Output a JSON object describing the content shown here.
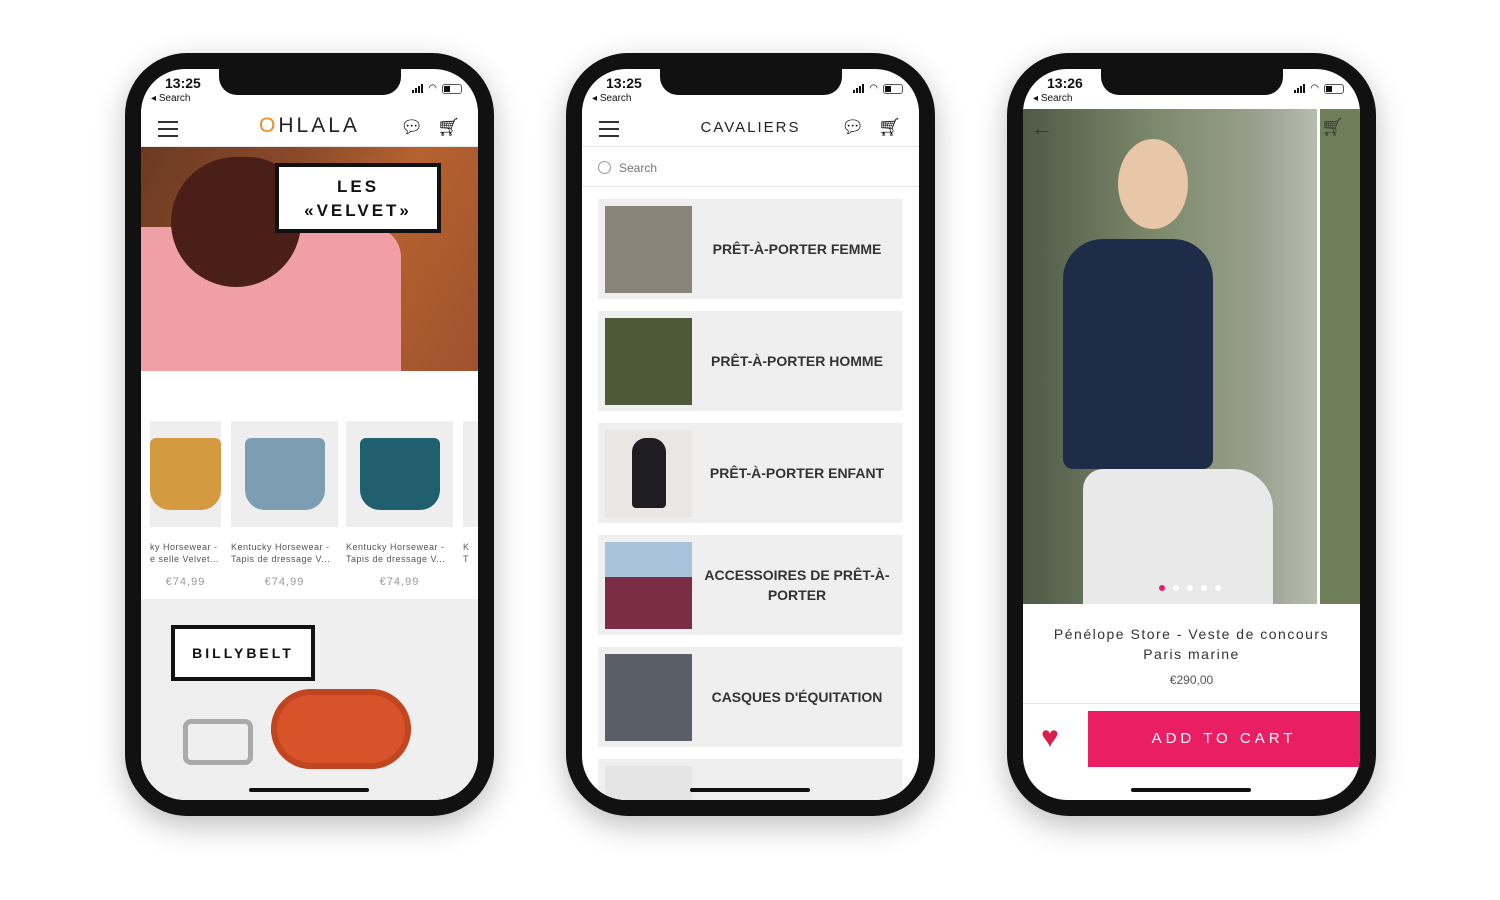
{
  "phones": [
    {
      "time": "13:25",
      "back": "Search",
      "logo_o": "O",
      "logo_rest": "HLALA",
      "hero": {
        "bubble": "LES «VELVET»"
      },
      "products": [
        {
          "title1": "ky Horsewear -",
          "title2": "e selle Velvet...",
          "price": "€74,99",
          "color": "#d39a3f"
        },
        {
          "title1": "Kentucky Horsewear -",
          "title2": "Tapis de dressage V...",
          "price": "€74,99",
          "color": "#7d9db2"
        },
        {
          "title1": "Kentucky Horsewear -",
          "title2": "Tapis de dressage V...",
          "price": "€74,99",
          "color": "#1f5f6e"
        },
        {
          "title1": "K",
          "title2": "T",
          "price": "",
          "color": "#eee"
        }
      ],
      "promo": {
        "bubble": "BILLYBELT"
      }
    },
    {
      "time": "13:25",
      "back": "Search",
      "title": "CAVALIERS",
      "search_placeholder": "Search",
      "categories": [
        {
          "label": "PRÊT-À-PORTER FEMME",
          "color": "#8a8478"
        },
        {
          "label": "PRÊT-À-PORTER HOMME",
          "color": "#4d5a3a"
        },
        {
          "label": "PRÊT-À-PORTER ENFANT",
          "color": "#e9e6e3"
        },
        {
          "label": "ACCESSOIRES DE PRÊT-À-PORTER",
          "color": "#7a2d45"
        },
        {
          "label": "CASQUES D'ÉQUITATION",
          "color": "#5a5e66"
        }
      ]
    },
    {
      "time": "13:26",
      "back": "Search",
      "product": {
        "title": "Pénélope Store - Veste de concours Paris marine",
        "price": "€290,00",
        "images": 5,
        "active_image": 1
      },
      "add_to_cart": "ADD TO CART",
      "accent": "#e91e63",
      "heart_color": "#d81f4f"
    }
  ]
}
